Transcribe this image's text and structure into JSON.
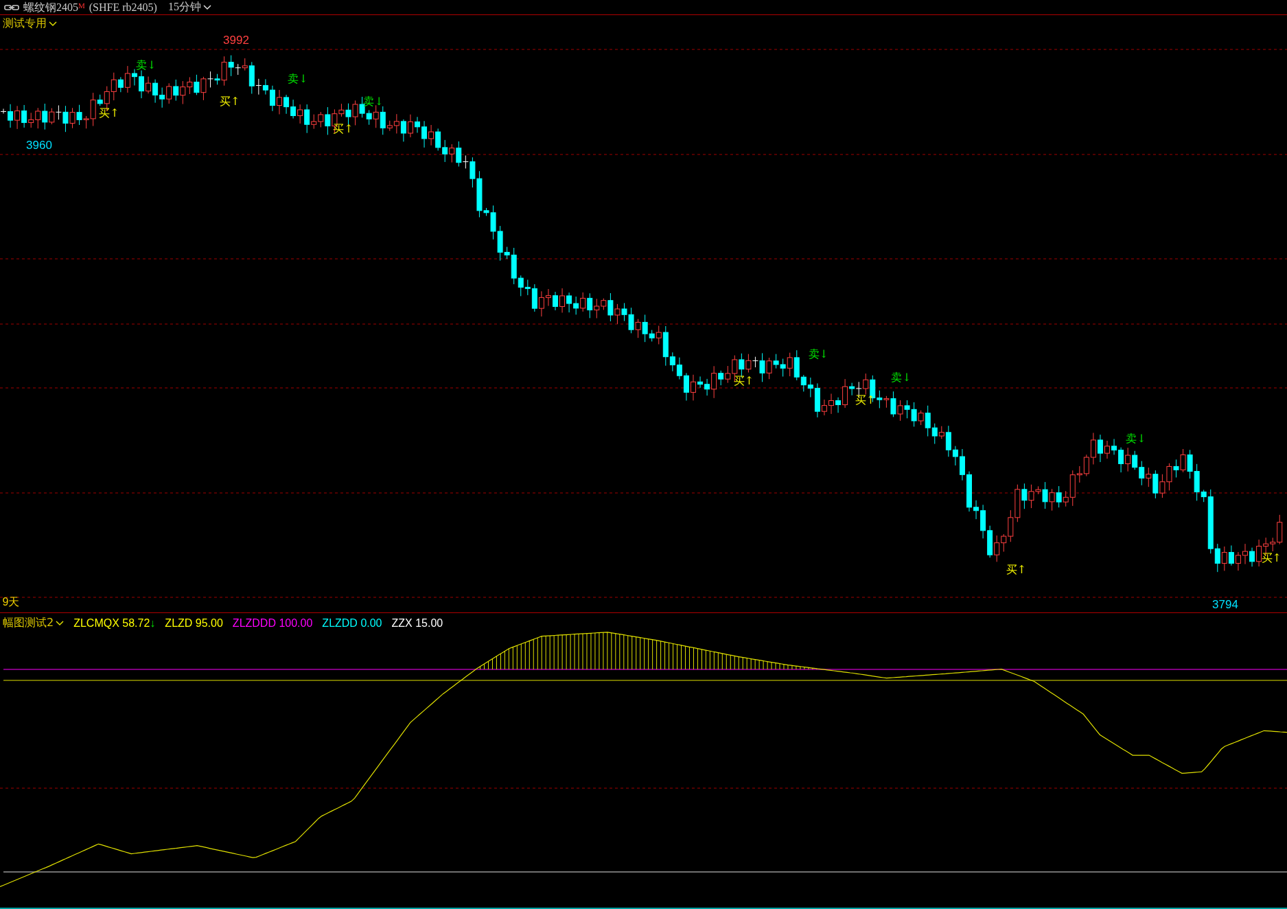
{
  "header": {
    "instrument": "螺纹钢2405",
    "contract_mark": "M",
    "exchange_code": "(SHFE rb2405)",
    "period": "15分钟"
  },
  "main_panel": {
    "indicator": "测试专用",
    "price_labels": [
      {
        "kind": "high",
        "text": "3992"
      },
      {
        "kind": "low",
        "text": "3960"
      },
      {
        "kind": "low",
        "text": "3794"
      }
    ],
    "range_label": "9天",
    "signals": [
      {
        "kind": "sell",
        "label": "卖↓"
      },
      {
        "kind": "sell",
        "label": "卖↓"
      },
      {
        "kind": "sell",
        "label": "卖↓"
      },
      {
        "kind": "sell",
        "label": "卖↓"
      },
      {
        "kind": "sell",
        "label": "卖↓"
      },
      {
        "kind": "sell",
        "label": "卖↓"
      },
      {
        "kind": "buy",
        "label": "买↑"
      },
      {
        "kind": "buy",
        "label": "买↑"
      },
      {
        "kind": "buy",
        "label": "买↑"
      },
      {
        "kind": "buy",
        "label": "买↑"
      },
      {
        "kind": "buy",
        "label": "买↑"
      },
      {
        "kind": "buy",
        "label": "买↑"
      },
      {
        "kind": "buy",
        "label": "买↑"
      }
    ]
  },
  "sub_panel": {
    "indicator": "幅图测试2",
    "legend": [
      {
        "name": "ZLCMQX",
        "value": "58.72",
        "arrow": "↓",
        "color": "#ffff00"
      },
      {
        "name": "ZLZD",
        "value": "95.00",
        "color": "#ffff00"
      },
      {
        "name": "ZLZDDD",
        "value": "100.00",
        "color": "#ff00ff"
      },
      {
        "name": "ZLZDD",
        "value": "0.00",
        "color": "#00ffff"
      },
      {
        "name": "ZZX",
        "value": "15.00",
        "color": "#ffffff"
      }
    ]
  }
}
